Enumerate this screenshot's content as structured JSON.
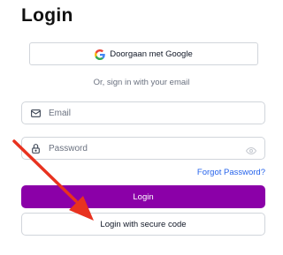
{
  "title": "Login",
  "google_button": {
    "label": "Doorgaan met Google",
    "icon": "google-g-icon"
  },
  "divider_text": "Or, sign in with your email",
  "email_field": {
    "placeholder": "Email",
    "value": "",
    "icon": "mail-icon"
  },
  "password_field": {
    "placeholder": "Password",
    "value": "",
    "icon": "lock-icon",
    "toggle_icon": "eye-icon"
  },
  "forgot_password": "Forgot Password?",
  "login_button": "Login",
  "secure_code_button": "Login with secure code",
  "colors": {
    "primary": "#8b00a8",
    "link": "#2563eb",
    "annotation_arrow": "#e8321f"
  }
}
